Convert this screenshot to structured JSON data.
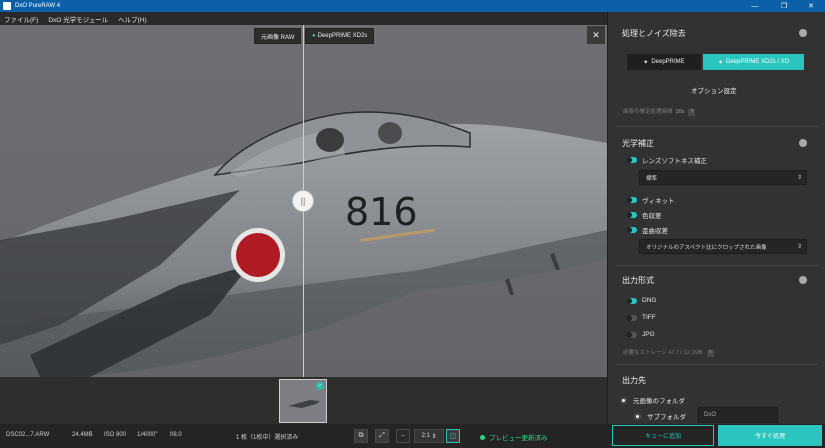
{
  "window": {
    "title": "DxO PureRAW 4"
  },
  "menu": {
    "items": [
      "ファイル(F)",
      "DxO 光学モジュール",
      "ヘルプ(H)"
    ]
  },
  "viewer": {
    "left_tag": "元画像 RAW",
    "right_tag": "DeepPRIME XD2s",
    "close_glyph": "✕",
    "aircraft_number": "816"
  },
  "panel": {
    "denoise": {
      "title": "処理とノイズ除去",
      "btn_deepprime": "DeepPRIME",
      "btn_xd": "DeepPRIME XD2s / XD",
      "options_link": "オプション設定",
      "estimate_label": "画像の推定処理時間",
      "estimate_value": "28s"
    },
    "optical": {
      "title": "光学補正",
      "lens_softness": "レンズソフトネス補正",
      "lens_select": "標準",
      "vignette": "ヴィネット",
      "chromatic": "色収差",
      "distortion": "歪曲収差",
      "distortion_select": "オリジナルのアスペクト比にクロップされた画像"
    },
    "output_format": {
      "title": "出力形式",
      "options": [
        "DNG",
        "TIFF",
        "JPG"
      ],
      "selected": "DNG",
      "storage_note": "必要なストレージ 47.7 / 12.1MB"
    },
    "destination": {
      "title": "出力先",
      "source_folder": "元画像のフォルダ",
      "subfolder": "サブフォルダ",
      "subfolder_value": "DxO"
    }
  },
  "status": {
    "filename": "DSC02...7.ARW",
    "filesize": "24.4MB",
    "iso": "ISO 800",
    "shutter": "1/4000\"",
    "aperture": "f/8.0",
    "selection": "1 枚（1枚中）選択済み",
    "zoom": "2:1",
    "preview": "プレビュー更新済み",
    "queue_button": "キューに追加",
    "process_button": "今すぐ処理"
  },
  "colors": {
    "accent": "#2bc5c0",
    "titlebar": "#0d5fa8",
    "preview_ok": "#2bd68a"
  }
}
